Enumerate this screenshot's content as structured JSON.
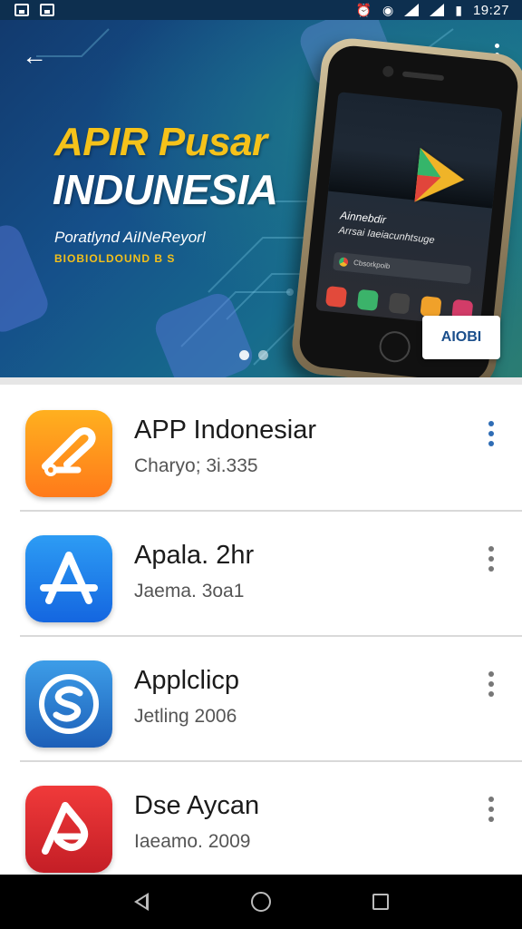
{
  "status_bar": {
    "time": "19:27",
    "left_icons": [
      "image-icon",
      "image-icon"
    ],
    "right_icons": [
      "alarm-icon",
      "notification-icon",
      "signal-icon",
      "signal-icon",
      "battery-icon"
    ]
  },
  "banner": {
    "headline_line1": "APIR Pusar",
    "headline_line2": "INDUNESIA",
    "tagline": "Poratlynd AiINeReyorl",
    "tagline_small": "BIOBIOLDOUND B S",
    "phone_title": "Ainnebdir",
    "phone_subtitle": "Arrsai Iaeiacunhtsuge",
    "phone_search": "Cbsorkpoib",
    "badge_text": "AIOBI",
    "carousel_total": 2,
    "carousel_active": 1,
    "colors": {
      "headline_yellow": "#f5c21a",
      "badge_blue": "#1b4f8c"
    }
  },
  "apps": [
    {
      "name": "APP Indonesiar",
      "meta": "Charyo; 3i.335",
      "icon": "route-icon",
      "icon_colors": [
        "#ffb01f",
        "#ff7a1a"
      ]
    },
    {
      "name": "Apala. 2hr",
      "meta": "Jaema. 3oa1",
      "icon": "app-store-a-icon",
      "icon_colors": [
        "#2d9cf4",
        "#1466e0"
      ]
    },
    {
      "name": "Applclicp",
      "meta": "Jetling 2006",
      "icon": "s-circle-icon",
      "icon_colors": [
        "#3d9de8",
        "#1d5fb8"
      ]
    },
    {
      "name": "Dse Aycan",
      "meta": "Iaeamo. 2009",
      "icon": "red-a-icon",
      "icon_colors": [
        "#f03a3a",
        "#c41e26"
      ]
    }
  ],
  "nav": {
    "buttons": [
      "back-icon",
      "home-icon",
      "recents-icon"
    ]
  }
}
